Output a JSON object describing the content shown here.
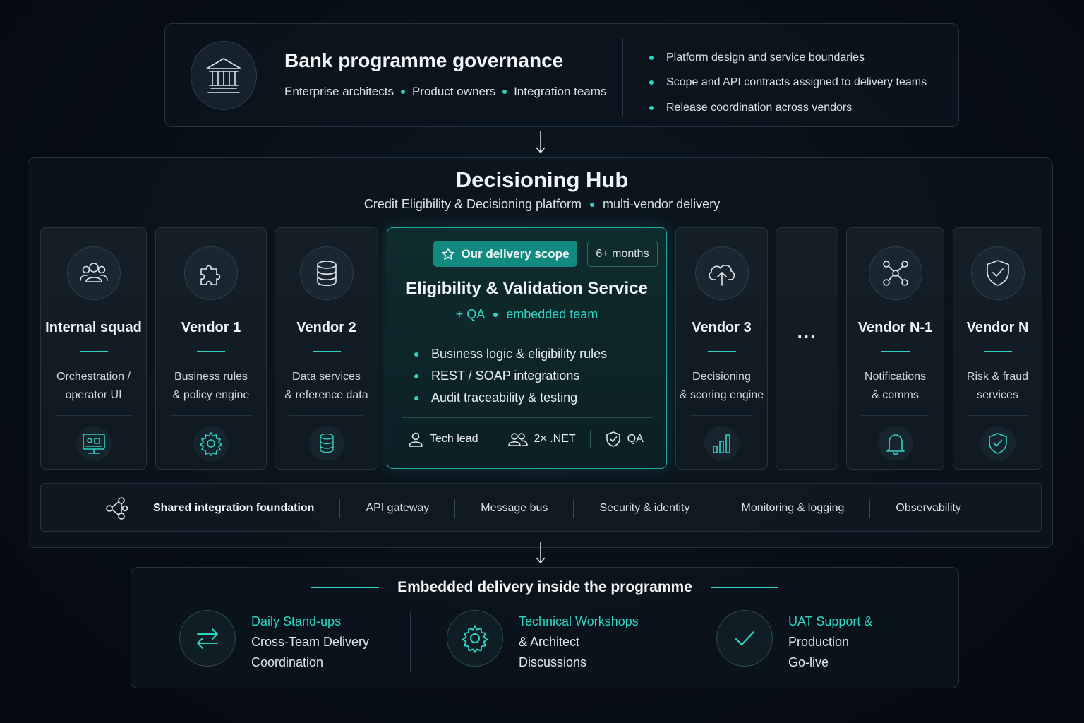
{
  "governance": {
    "title": "Bank programme governance",
    "roles": [
      "Enterprise architects",
      "Product owners",
      "Integration teams"
    ],
    "responsibilities": [
      "Platform design and service boundaries",
      "Scope and API contracts assigned to delivery teams",
      "Release coordination across vendors"
    ]
  },
  "hub": {
    "title": "Decisioning Hub",
    "subtitle_left": "Credit Eligibility & Decisioning platform",
    "subtitle_right": "multi-vendor delivery"
  },
  "cards": {
    "internal": {
      "name": "Internal squad",
      "desc1": "Orchestration /",
      "desc2": "operator UI"
    },
    "vendor1": {
      "name": "Vendor 1",
      "desc1": "Business rules",
      "desc2": "& policy engine"
    },
    "vendor2": {
      "name": "Vendor 2",
      "desc1": "Data services",
      "desc2": "& reference data"
    },
    "vendor3": {
      "name": "Vendor 3",
      "desc1": "Decisioning",
      "desc2": "& scoring engine"
    },
    "more": {
      "label": "..."
    },
    "vendorN1": {
      "name": "Vendor N-1",
      "desc1": "Notifications",
      "desc2": "& comms"
    },
    "vendorN": {
      "name": "Vendor N",
      "desc1": "Risk & fraud",
      "desc2": "services"
    }
  },
  "featured": {
    "badge": "Our delivery scope",
    "duration": "6+ months",
    "title": "Eligibility & Validation Service",
    "sub_left": "+ QA",
    "sub_right": "embedded team",
    "bullets": [
      "Business logic & eligibility rules",
      "REST / SOAP integrations",
      "Audit traceability & testing"
    ],
    "team": {
      "lead": "Tech lead",
      "devs": "2× .NET",
      "qa": "QA"
    }
  },
  "foundation": {
    "label": "Shared integration foundation",
    "items": [
      "API gateway",
      "Message bus",
      "Security & identity",
      "Monitoring & logging",
      "Observability"
    ]
  },
  "embedded": {
    "title": "Embedded delivery inside the programme",
    "items": [
      {
        "highlight": "Daily Stand-ups",
        "line1": "Cross-Team Delivery",
        "line2": "Coordination",
        "icon": "swap-arrows-icon"
      },
      {
        "highlight": "Technical Workshops",
        "line1": "& Architect",
        "line2": "Discussions",
        "icon": "gear-icon"
      },
      {
        "highlight": "UAT Support &",
        "line1": "Production",
        "line2": "Go-live",
        "icon": "checkmark-icon"
      }
    ]
  },
  "colors": {
    "accent": "#2fd4c2",
    "background": "#070d14",
    "panel_border": "#24343f"
  }
}
